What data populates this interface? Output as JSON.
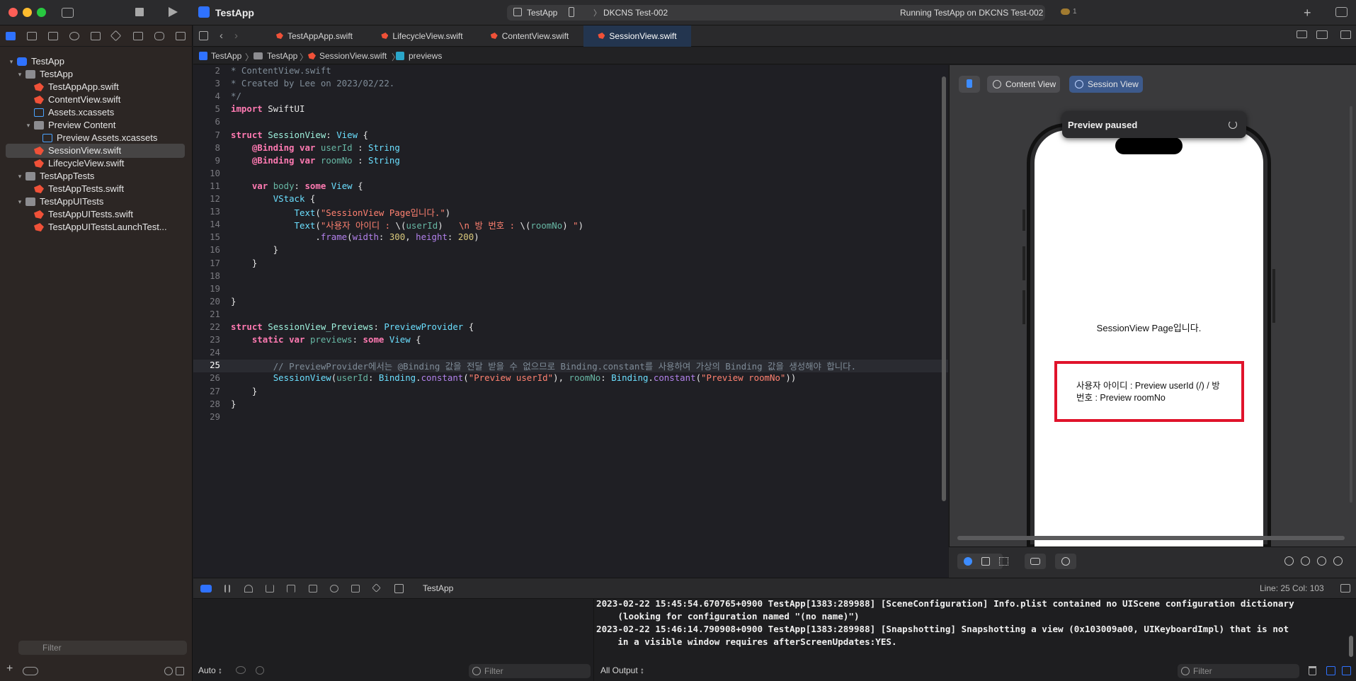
{
  "window": {
    "title": "TestApp"
  },
  "toolbar": {
    "scheme_app": "TestApp",
    "scheme_device": "DKCNS Test-002",
    "run_status": "Running TestApp on DKCNS Test-002",
    "cloud_badge": "1"
  },
  "navigator": {
    "items": [
      {
        "label": "TestApp",
        "icon": "project-icon",
        "disclosure": "⌄"
      },
      {
        "label": "TestApp",
        "icon": "folder-icon",
        "disclosure": "⌄"
      },
      {
        "label": "TestAppApp.swift",
        "icon": "swift-file-icon"
      },
      {
        "label": "ContentView.swift",
        "icon": "swift-file-icon"
      },
      {
        "label": "Assets.xcassets",
        "icon": "assets-icon"
      },
      {
        "label": "Preview Content",
        "icon": "folder-icon",
        "disclosure": "⌄"
      },
      {
        "label": "Preview Assets.xcassets",
        "icon": "assets-icon"
      },
      {
        "label": "SessionView.swift",
        "icon": "swift-file-icon",
        "selected": true
      },
      {
        "label": "LifecycleView.swift",
        "icon": "swift-file-icon"
      },
      {
        "label": "TestAppTests",
        "icon": "folder-icon",
        "disclosure": "⌄"
      },
      {
        "label": "TestAppTests.swift",
        "icon": "swift-file-icon"
      },
      {
        "label": "TestAppUITests",
        "icon": "folder-icon",
        "disclosure": "⌄"
      },
      {
        "label": "TestAppUITests.swift",
        "icon": "swift-file-icon"
      },
      {
        "label": "TestAppUITestsLaunchTest...",
        "icon": "swift-file-icon"
      }
    ],
    "filter_placeholder": "Filter"
  },
  "tabs": [
    {
      "label": "TestAppApp.swift"
    },
    {
      "label": "LifecycleView.swift"
    },
    {
      "label": "ContentView.swift"
    },
    {
      "label": "SessionView.swift",
      "active": true
    }
  ],
  "breadcrumb": [
    "TestApp",
    "TestApp",
    "SessionView.swift",
    "previews"
  ],
  "editor": {
    "current_line": 25,
    "lines": [
      {
        "n": "2",
        "t": [
          [
            "cm",
            "* ContentView.swift"
          ]
        ]
      },
      {
        "n": "3",
        "t": [
          [
            "cm",
            "* Created by Lee on 2023/02/22."
          ]
        ]
      },
      {
        "n": "4",
        "t": [
          [
            "cm",
            "*/"
          ]
        ]
      },
      {
        "n": "5",
        "t": [
          [
            "kw",
            "import"
          ],
          [
            "",
            " SwiftUI"
          ]
        ]
      },
      {
        "n": "6",
        "t": []
      },
      {
        "n": "7",
        "t": [
          [
            "kw",
            "struct"
          ],
          [
            "",
            " "
          ],
          [
            "nm",
            "SessionView"
          ],
          [
            "",
            ": "
          ],
          [
            "ty",
            "View"
          ],
          [
            "",
            " {"
          ]
        ]
      },
      {
        "n": "8",
        "t": [
          [
            "",
            "    "
          ],
          [
            "kw",
            "@Binding"
          ],
          [
            "",
            " "
          ],
          [
            "kw",
            "var"
          ],
          [
            "",
            " "
          ],
          [
            "pv",
            "userId"
          ],
          [
            "",
            " : "
          ],
          [
            "ty",
            "String"
          ]
        ]
      },
      {
        "n": "9",
        "t": [
          [
            "",
            "    "
          ],
          [
            "kw",
            "@Binding"
          ],
          [
            "",
            " "
          ],
          [
            "kw",
            "var"
          ],
          [
            "",
            " "
          ],
          [
            "pv",
            "roomNo"
          ],
          [
            "",
            " : "
          ],
          [
            "ty",
            "String"
          ]
        ]
      },
      {
        "n": "10",
        "t": []
      },
      {
        "n": "11",
        "t": [
          [
            "",
            "    "
          ],
          [
            "kw",
            "var"
          ],
          [
            "",
            " "
          ],
          [
            "pv",
            "body"
          ],
          [
            "",
            ": "
          ],
          [
            "kw",
            "some"
          ],
          [
            "",
            " "
          ],
          [
            "ty",
            "View"
          ],
          [
            "",
            " {"
          ]
        ]
      },
      {
        "n": "12",
        "t": [
          [
            "",
            "        "
          ],
          [
            "ty",
            "VStack"
          ],
          [
            "",
            " {"
          ]
        ]
      },
      {
        "n": "13",
        "t": [
          [
            "",
            "            "
          ],
          [
            "ty",
            "Text"
          ],
          [
            "",
            "("
          ],
          [
            "str",
            "\"SessionView Page입니다.\""
          ],
          [
            "",
            ")"
          ]
        ]
      },
      {
        "n": "14",
        "t": [
          [
            "",
            "            "
          ],
          [
            "ty",
            "Text"
          ],
          [
            "",
            "("
          ],
          [
            "str",
            "\"사용자 아이디 : "
          ],
          [
            "",
            "\\("
          ],
          [
            "pv",
            "userId"
          ],
          [
            "",
            ")   "
          ],
          [
            "str",
            "\\n 방 번호 : "
          ],
          [
            "",
            "\\("
          ],
          [
            "pv",
            "roomNo"
          ],
          [
            "",
            ") "
          ],
          [
            "str",
            "\""
          ],
          [
            "",
            ")"
          ]
        ]
      },
      {
        "n": "15",
        "t": [
          [
            "",
            "                ."
          ],
          [
            "ot",
            "frame"
          ],
          [
            "",
            "("
          ],
          [
            "ot",
            "width"
          ],
          [
            "",
            ": "
          ],
          [
            "num",
            "300"
          ],
          [
            "",
            ", "
          ],
          [
            "ot",
            "height"
          ],
          [
            "",
            ": "
          ],
          [
            "num",
            "200"
          ],
          [
            "",
            ")"
          ]
        ]
      },
      {
        "n": "16",
        "t": [
          [
            "",
            "        }"
          ]
        ]
      },
      {
        "n": "17",
        "t": [
          [
            "",
            "    }"
          ]
        ]
      },
      {
        "n": "18",
        "t": []
      },
      {
        "n": "19",
        "t": []
      },
      {
        "n": "20",
        "t": [
          [
            "",
            "}"
          ]
        ]
      },
      {
        "n": "21",
        "t": []
      },
      {
        "n": "22",
        "t": [
          [
            "kw",
            "struct"
          ],
          [
            "",
            " "
          ],
          [
            "nm",
            "SessionView_Previews"
          ],
          [
            "",
            ": "
          ],
          [
            "ty",
            "PreviewProvider"
          ],
          [
            "",
            " {"
          ]
        ]
      },
      {
        "n": "23",
        "t": [
          [
            "",
            "    "
          ],
          [
            "kw",
            "static"
          ],
          [
            "",
            " "
          ],
          [
            "kw",
            "var"
          ],
          [
            "",
            " "
          ],
          [
            "pv",
            "previews"
          ],
          [
            "",
            ": "
          ],
          [
            "kw",
            "some"
          ],
          [
            "",
            " "
          ],
          [
            "ty",
            "View"
          ],
          [
            "",
            " {"
          ]
        ]
      },
      {
        "n": "24",
        "t": []
      },
      {
        "n": "25",
        "t": [
          [
            "",
            "        "
          ],
          [
            "cm",
            "// PreviewProvider에서는 @Binding 값을 전달 받을 수 없으므로 Binding.constant를 사용하여 가상의 Binding 값을 생성해야 합니다."
          ]
        ]
      },
      {
        "n": "26",
        "t": [
          [
            "",
            "        "
          ],
          [
            "ty",
            "SessionView"
          ],
          [
            "",
            "("
          ],
          [
            "pv",
            "userId"
          ],
          [
            "",
            ": "
          ],
          [
            "ty",
            "Binding"
          ],
          [
            "",
            "."
          ],
          [
            "ot",
            "constant"
          ],
          [
            "",
            "("
          ],
          [
            "str",
            "\"Preview userId\""
          ],
          [
            "",
            "), "
          ],
          [
            "pv",
            "roomNo"
          ],
          [
            "",
            ": "
          ],
          [
            "ty",
            "Binding"
          ],
          [
            "",
            "."
          ],
          [
            "ot",
            "constant"
          ],
          [
            "",
            "("
          ],
          [
            "str",
            "\"Preview roomNo\""
          ],
          [
            "",
            "))"
          ]
        ]
      },
      {
        "n": "27",
        "t": [
          [
            "",
            "    }"
          ]
        ]
      },
      {
        "n": "28",
        "t": [
          [
            "",
            "}"
          ]
        ]
      },
      {
        "n": "29",
        "t": []
      }
    ]
  },
  "canvas": {
    "chips": [
      "Content View",
      "Session View"
    ],
    "preview_status": "Preview paused",
    "screen_title": "SessionView Page입니다.",
    "screen_text": "사용자 아이디 : Preview userId (/) / 방 번호 : Preview roomNo"
  },
  "debug": {
    "app_label": "TestApp",
    "line_col": "Line: 25  Col: 103",
    "variables_mode": "Auto ↕",
    "variables_filter_placeholder": "Filter",
    "output_mode": "All Output ↕",
    "console_filter_placeholder": "Filter",
    "console_lines": [
      "2023-02-22 15:45:54.670765+0900 TestApp[1383:289988] [SceneConfiguration] Info.plist contained no UIScene configuration dictionary",
      "    (looking for configuration named \"(no name)\")",
      "2023-02-22 15:46:14.790908+0900 TestApp[1383:289988] [Snapshotting] Snapshotting a view (0x103009a00, UIKeyboardImpl) that is not",
      "    in a visible window requires afterScreenUpdates:YES."
    ]
  },
  "colors": {
    "accent": "#2f72ff",
    "swift": "#f05138",
    "highlight_box": "#e0132b",
    "close": "#ff5f57",
    "minimize": "#febc2e",
    "zoom": "#28c840"
  }
}
